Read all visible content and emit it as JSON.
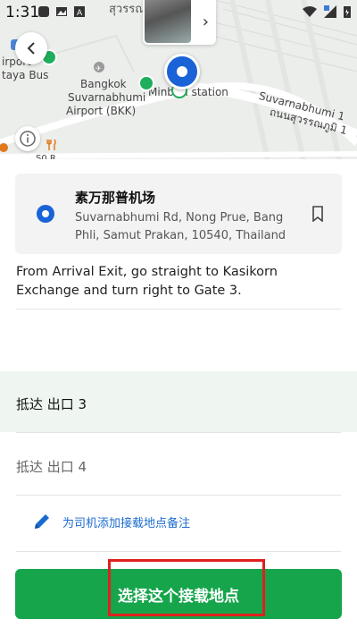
{
  "status_bar": {
    "time": "1:31"
  },
  "map": {
    "labels": {
      "thai_top": "สุวรรณ",
      "airport_bus_1": "irport",
      "airport_bus_2": "taya Bus",
      "airport_1": "Bangkok",
      "airport_2": "Suvarnabhumi",
      "airport_3": "Airport (BKK)",
      "station": "Minburi station",
      "road_en": "Suvarnabhumi 1",
      "road_th": "ถนนสุวรรณภูมิ 1",
      "bottom": "S0 R"
    }
  },
  "location": {
    "name": "素万那普机场",
    "address": "Suvarnabhumi Rd, Nong Prue, Bang Phli, Samut Prakan, 10540, Thailand"
  },
  "instruction": "From Arrival Exit, go straight to Kasikorn Exchange and turn right to Gate 3.",
  "gates": {
    "selected_label": "抵达 出口 3",
    "other_label": "抵达 出口 4"
  },
  "note": {
    "label": "为司机添加接载地点备注"
  },
  "cta": {
    "label": "选择这个接载地点"
  },
  "colors": {
    "accent_green": "#16a54b",
    "link_blue": "#1a6bd0",
    "pin_blue": "#1a63d6",
    "highlight_red": "#e02020"
  }
}
